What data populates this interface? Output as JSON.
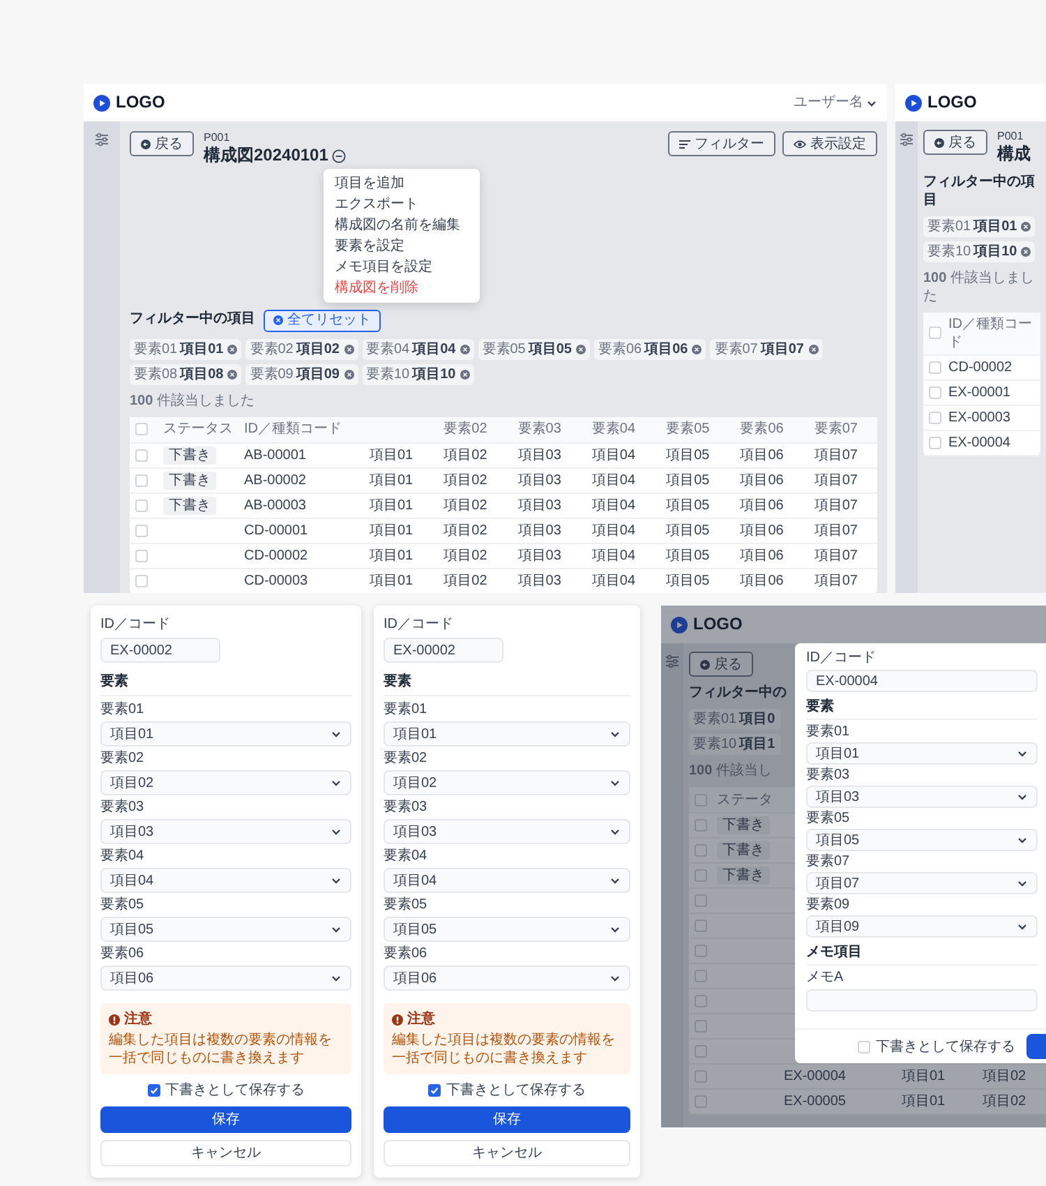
{
  "main_screen": {
    "logo": "LOGO",
    "user_name": "ユーザー名",
    "back_button": "戻る",
    "project_code": "P001",
    "diagram_title": "構成図20240101",
    "filter_button": "フィルター",
    "display_button": "表示設定",
    "filter_label": "フィルター中の項目",
    "reset_button": "全てリセット",
    "chips": [
      {
        "label": "要素01",
        "value": "項目01"
      },
      {
        "label": "要素02",
        "value": "項目02"
      },
      {
        "label": "要素04",
        "value": "項目04"
      },
      {
        "label": "要素05",
        "value": "項目05"
      },
      {
        "label": "要素06",
        "value": "項目06"
      },
      {
        "label": "要素07",
        "value": "項目07"
      },
      {
        "label": "要素08",
        "value": "項目08"
      },
      {
        "label": "要素09",
        "value": "項目09"
      },
      {
        "label": "要素10",
        "value": "項目10"
      }
    ],
    "result_text": "**100** 件該当しました",
    "all_checked": false,
    "columns": [
      "ステータス",
      "ID／種類コード"
    ],
    "element_columns": [
      "要素02",
      "要素03",
      "要素04",
      "要素05",
      "要素06",
      "要素07"
    ],
    "rows": [
      {
        "checked": false,
        "status": "下書き",
        "id": "AB-00001",
        "cells": [
          "項目01",
          "項目02",
          "項目03",
          "項目04",
          "項目05",
          "項目06",
          "項目07"
        ]
      },
      {
        "checked": false,
        "status": "下書き",
        "id": "AB-00002",
        "cells": [
          "項目01",
          "項目02",
          "項目03",
          "項目04",
          "項目05",
          "項目06",
          "項目07"
        ]
      },
      {
        "checked": false,
        "status": "下書き",
        "id": "AB-00003",
        "cells": [
          "項目01",
          "項目02",
          "項目03",
          "項目04",
          "項目05",
          "項目06",
          "項目07"
        ]
      },
      {
        "checked": false,
        "id": "CD-00001",
        "cells": [
          "項目01",
          "項目02",
          "項目03",
          "項目04",
          "項目05",
          "項目06",
          "項目07"
        ]
      },
      {
        "checked": false,
        "id": "CD-00002",
        "cells": [
          "項目01",
          "項目02",
          "項目03",
          "項目04",
          "項目05",
          "項目06",
          "項目07"
        ]
      },
      {
        "checked": false,
        "id": "CD-00003",
        "cells": [
          "項目01",
          "項目02",
          "項目03",
          "項目04",
          "項目05",
          "項目06",
          "項目07"
        ]
      }
    ],
    "menu": [
      {
        "label": "項目を追加",
        "kind": "normal"
      },
      {
        "label": "エクスポート",
        "kind": "normal"
      },
      {
        "label": "構成図の名前を編集",
        "kind": "normal"
      },
      {
        "label": "要素を設定",
        "kind": "normal"
      },
      {
        "label": "メモ項目を設定",
        "kind": "normal"
      },
      {
        "label": "構成図を削除",
        "kind": "danger"
      }
    ]
  },
  "side_screen": {
    "logo": "LOGO",
    "back_button": "戻る",
    "project_code": "P001",
    "diagram_title": "構成",
    "filter_label": "フィルター中の項目",
    "chips": [
      {
        "label": "要素01",
        "value": "項目01"
      },
      {
        "label": "要素10",
        "value": "項目10"
      }
    ],
    "result_text": "**100** 件該当しました",
    "all_checked": false,
    "column": "ID／種類コード",
    "rows": [
      {
        "checked": false,
        "id": "CD-00002"
      },
      {
        "checked": false,
        "id": "EX-00001"
      },
      {
        "checked": false,
        "id": "EX-00003"
      },
      {
        "checked": false,
        "id": "EX-00004"
      }
    ]
  },
  "edit_forms": [
    {
      "id_label": "ID／コード",
      "id_value": "EX-00002",
      "section": "要素",
      "fields": [
        {
          "label": "要素01",
          "value": "項目01"
        },
        {
          "label": "要素02",
          "value": "項目02"
        },
        {
          "label": "要素03",
          "value": "項目03"
        },
        {
          "label": "要素04",
          "value": "項目04"
        },
        {
          "label": "要素05",
          "value": "項目05"
        },
        {
          "label": "要素06",
          "value": "項目06"
        }
      ],
      "notice": {
        "title": "注意",
        "message": "編集した項目は複数の要素の情報を一括で同じものに書き換えます"
      },
      "draft": {
        "label": "下書きとして保存する",
        "checked": true
      },
      "save_button": "保存",
      "cancel_button": "キャンセル"
    },
    {
      "id_label": "ID／コード",
      "id_value": "EX-00002",
      "section": "要素",
      "fields": [
        {
          "label": "要素01",
          "value": "項目01"
        },
        {
          "label": "要素02",
          "value": "項目02"
        },
        {
          "label": "要素03",
          "value": "項目03"
        },
        {
          "label": "要素04",
          "value": "項目04"
        },
        {
          "label": "要素05",
          "value": "項目05"
        },
        {
          "label": "要素06",
          "value": "項目06"
        }
      ],
      "notice": {
        "title": "注意",
        "message": "編集した項目は複数の要素の情報を一括で同じものに書き換えます"
      },
      "draft": {
        "label": "下書きとして保存する",
        "checked": true
      },
      "save_button": "保存",
      "cancel_button": "キャンセル"
    }
  ],
  "modal_screen": {
    "logo": "LOGO",
    "back_button": "戻る",
    "filter_label": "フィルター中の",
    "chips": [
      {
        "label": "要素01",
        "value": "項目0"
      },
      {
        "label": "要素10",
        "value": "項目1"
      }
    ],
    "result_text": "**100** 件該当し",
    "all_checked": false,
    "status_header": "ステータ",
    "rows": [
      {
        "checked": false,
        "status": "下書き"
      },
      {
        "checked": false,
        "status": "下書き"
      },
      {
        "checked": false,
        "status": "下書き"
      },
      {
        "checked": false
      },
      {
        "checked": false
      },
      {
        "checked": false
      },
      {
        "checked": false
      },
      {
        "checked": false
      },
      {
        "checked": false
      },
      {
        "checked": false
      },
      {
        "checked": false,
        "id": "EX-00004",
        "cells": [
          "項目01",
          "項目02"
        ]
      },
      {
        "checked": false,
        "id": "EX-00005",
        "cells": [
          "項目01",
          "項目02"
        ]
      }
    ],
    "modal": {
      "id_label": "ID／コード",
      "id_value": "EX-00004",
      "section": "要素",
      "fields": [
        {
          "label": "要素01",
          "value": "項目01"
        },
        {
          "label": "要素03",
          "value": "項目03"
        },
        {
          "label": "要素05",
          "value": "項目05"
        },
        {
          "label": "要素07",
          "value": "項目07"
        },
        {
          "label": "要素09",
          "value": "項目09"
        }
      ],
      "memo_section": "メモ項目",
      "memo_label": "メモA",
      "draft": {
        "label": "下書きとして保存する",
        "checked": false
      }
    }
  }
}
